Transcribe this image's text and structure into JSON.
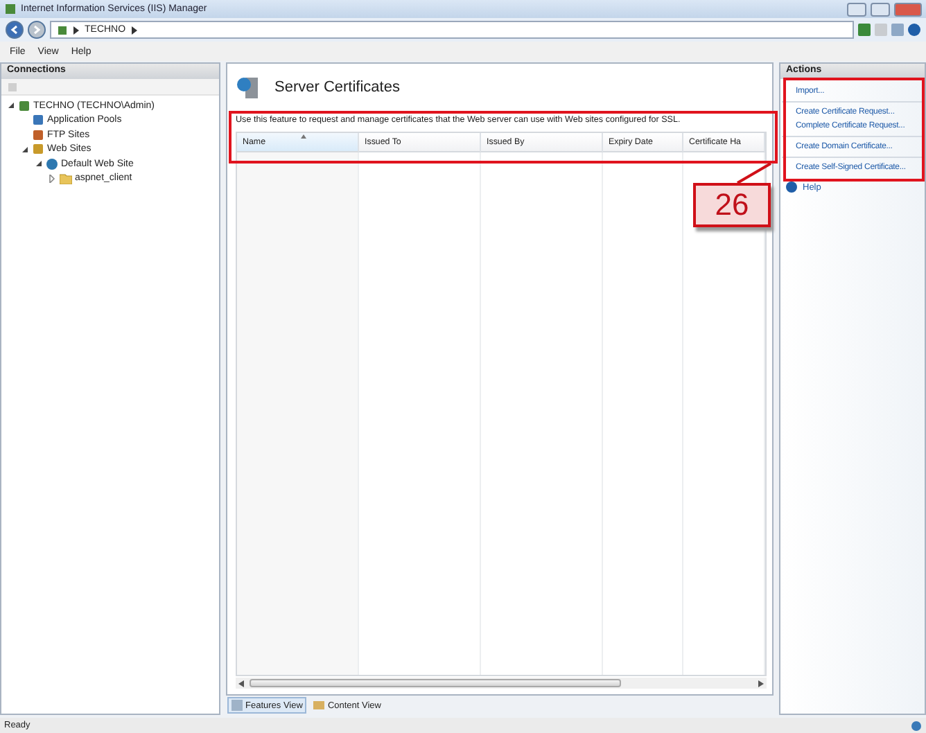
{
  "window": {
    "title": "Internet Information Services (IIS) Manager"
  },
  "address_bar": {
    "path": [
      "TECHNO"
    ]
  },
  "menu": [
    "File",
    "View",
    "Help"
  ],
  "connections": {
    "title": "Connections",
    "tree": [
      {
        "label": "TECHNO (TECHNO\\Admin)",
        "kind": "server",
        "expanded": true,
        "children": [
          {
            "label": "Application Pools",
            "kind": "pools"
          },
          {
            "label": "FTP Sites",
            "kind": "ftp"
          },
          {
            "label": "Web Sites",
            "kind": "sites",
            "expanded": true,
            "children": [
              {
                "label": "Default Web Site",
                "kind": "site",
                "expanded": true,
                "children": [
                  {
                    "label": "aspnet_client",
                    "kind": "folder",
                    "expanded": false
                  }
                ]
              }
            ]
          }
        ]
      }
    ]
  },
  "feature": {
    "title": "Server Certificates",
    "description": "Use this feature to request and manage certificates that the Web server can use with Web sites configured for SSL.",
    "columns": [
      {
        "label": "Name",
        "sorted": true
      },
      {
        "label": "Issued To",
        "sorted": false
      },
      {
        "label": "Issued By",
        "sorted": false
      },
      {
        "label": "Expiry Date",
        "sorted": false
      },
      {
        "label": "Certificate Ha",
        "sorted": false
      }
    ]
  },
  "view_tabs": [
    {
      "label": "Features View",
      "kind": "features",
      "selected": true
    },
    {
      "label": "Content View",
      "kind": "content",
      "selected": false
    }
  ],
  "actions": {
    "title": "Actions",
    "items": [
      {
        "label": "Import...",
        "kind": "link"
      },
      {
        "kind": "separator"
      },
      {
        "label": "Create Certificate Request...",
        "kind": "link"
      },
      {
        "label": "Complete Certificate Request...",
        "kind": "link"
      },
      {
        "kind": "separator"
      },
      {
        "label": "Create Domain Certificate...",
        "kind": "link"
      },
      {
        "kind": "separator"
      },
      {
        "label": "Create Self-Signed Certificate...",
        "kind": "link"
      },
      {
        "label": "Help",
        "kind": "help"
      }
    ]
  },
  "annotation": {
    "label": "26"
  },
  "status_bar": {
    "text": "Ready"
  }
}
